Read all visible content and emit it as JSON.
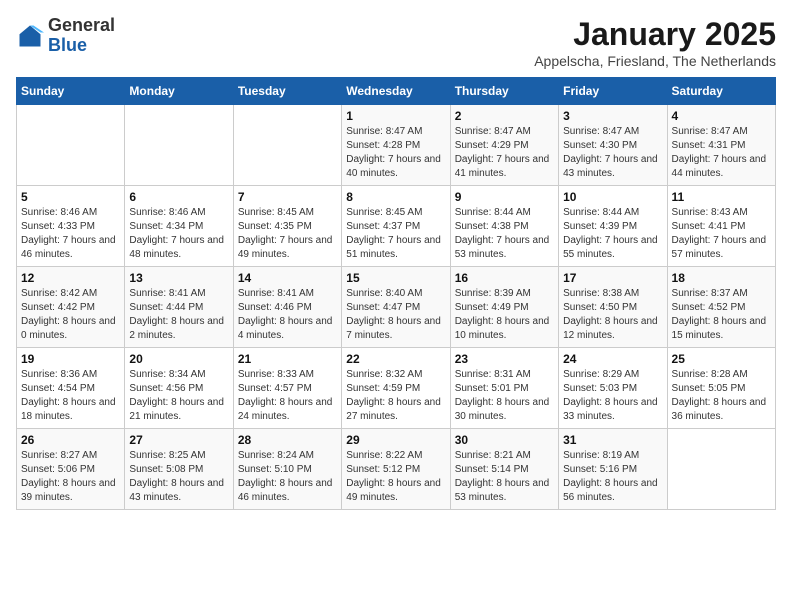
{
  "header": {
    "logo_general": "General",
    "logo_blue": "Blue",
    "title": "January 2025",
    "subtitle": "Appelscha, Friesland, The Netherlands"
  },
  "weekdays": [
    "Sunday",
    "Monday",
    "Tuesday",
    "Wednesday",
    "Thursday",
    "Friday",
    "Saturday"
  ],
  "weeks": [
    [
      null,
      null,
      null,
      {
        "day": "1",
        "sunrise": "8:47 AM",
        "sunset": "4:28 PM",
        "daylight": "7 hours and 40 minutes."
      },
      {
        "day": "2",
        "sunrise": "8:47 AM",
        "sunset": "4:29 PM",
        "daylight": "7 hours and 41 minutes."
      },
      {
        "day": "3",
        "sunrise": "8:47 AM",
        "sunset": "4:30 PM",
        "daylight": "7 hours and 43 minutes."
      },
      {
        "day": "4",
        "sunrise": "8:47 AM",
        "sunset": "4:31 PM",
        "daylight": "7 hours and 44 minutes."
      }
    ],
    [
      {
        "day": "5",
        "sunrise": "8:46 AM",
        "sunset": "4:33 PM",
        "daylight": "7 hours and 46 minutes."
      },
      {
        "day": "6",
        "sunrise": "8:46 AM",
        "sunset": "4:34 PM",
        "daylight": "7 hours and 48 minutes."
      },
      {
        "day": "7",
        "sunrise": "8:45 AM",
        "sunset": "4:35 PM",
        "daylight": "7 hours and 49 minutes."
      },
      {
        "day": "8",
        "sunrise": "8:45 AM",
        "sunset": "4:37 PM",
        "daylight": "7 hours and 51 minutes."
      },
      {
        "day": "9",
        "sunrise": "8:44 AM",
        "sunset": "4:38 PM",
        "daylight": "7 hours and 53 minutes."
      },
      {
        "day": "10",
        "sunrise": "8:44 AM",
        "sunset": "4:39 PM",
        "daylight": "7 hours and 55 minutes."
      },
      {
        "day": "11",
        "sunrise": "8:43 AM",
        "sunset": "4:41 PM",
        "daylight": "7 hours and 57 minutes."
      }
    ],
    [
      {
        "day": "12",
        "sunrise": "8:42 AM",
        "sunset": "4:42 PM",
        "daylight": "8 hours and 0 minutes."
      },
      {
        "day": "13",
        "sunrise": "8:41 AM",
        "sunset": "4:44 PM",
        "daylight": "8 hours and 2 minutes."
      },
      {
        "day": "14",
        "sunrise": "8:41 AM",
        "sunset": "4:46 PM",
        "daylight": "8 hours and 4 minutes."
      },
      {
        "day": "15",
        "sunrise": "8:40 AM",
        "sunset": "4:47 PM",
        "daylight": "8 hours and 7 minutes."
      },
      {
        "day": "16",
        "sunrise": "8:39 AM",
        "sunset": "4:49 PM",
        "daylight": "8 hours and 10 minutes."
      },
      {
        "day": "17",
        "sunrise": "8:38 AM",
        "sunset": "4:50 PM",
        "daylight": "8 hours and 12 minutes."
      },
      {
        "day": "18",
        "sunrise": "8:37 AM",
        "sunset": "4:52 PM",
        "daylight": "8 hours and 15 minutes."
      }
    ],
    [
      {
        "day": "19",
        "sunrise": "8:36 AM",
        "sunset": "4:54 PM",
        "daylight": "8 hours and 18 minutes."
      },
      {
        "day": "20",
        "sunrise": "8:34 AM",
        "sunset": "4:56 PM",
        "daylight": "8 hours and 21 minutes."
      },
      {
        "day": "21",
        "sunrise": "8:33 AM",
        "sunset": "4:57 PM",
        "daylight": "8 hours and 24 minutes."
      },
      {
        "day": "22",
        "sunrise": "8:32 AM",
        "sunset": "4:59 PM",
        "daylight": "8 hours and 27 minutes."
      },
      {
        "day": "23",
        "sunrise": "8:31 AM",
        "sunset": "5:01 PM",
        "daylight": "8 hours and 30 minutes."
      },
      {
        "day": "24",
        "sunrise": "8:29 AM",
        "sunset": "5:03 PM",
        "daylight": "8 hours and 33 minutes."
      },
      {
        "day": "25",
        "sunrise": "8:28 AM",
        "sunset": "5:05 PM",
        "daylight": "8 hours and 36 minutes."
      }
    ],
    [
      {
        "day": "26",
        "sunrise": "8:27 AM",
        "sunset": "5:06 PM",
        "daylight": "8 hours and 39 minutes."
      },
      {
        "day": "27",
        "sunrise": "8:25 AM",
        "sunset": "5:08 PM",
        "daylight": "8 hours and 43 minutes."
      },
      {
        "day": "28",
        "sunrise": "8:24 AM",
        "sunset": "5:10 PM",
        "daylight": "8 hours and 46 minutes."
      },
      {
        "day": "29",
        "sunrise": "8:22 AM",
        "sunset": "5:12 PM",
        "daylight": "8 hours and 49 minutes."
      },
      {
        "day": "30",
        "sunrise": "8:21 AM",
        "sunset": "5:14 PM",
        "daylight": "8 hours and 53 minutes."
      },
      {
        "day": "31",
        "sunrise": "8:19 AM",
        "sunset": "5:16 PM",
        "daylight": "8 hours and 56 minutes."
      },
      null
    ]
  ]
}
